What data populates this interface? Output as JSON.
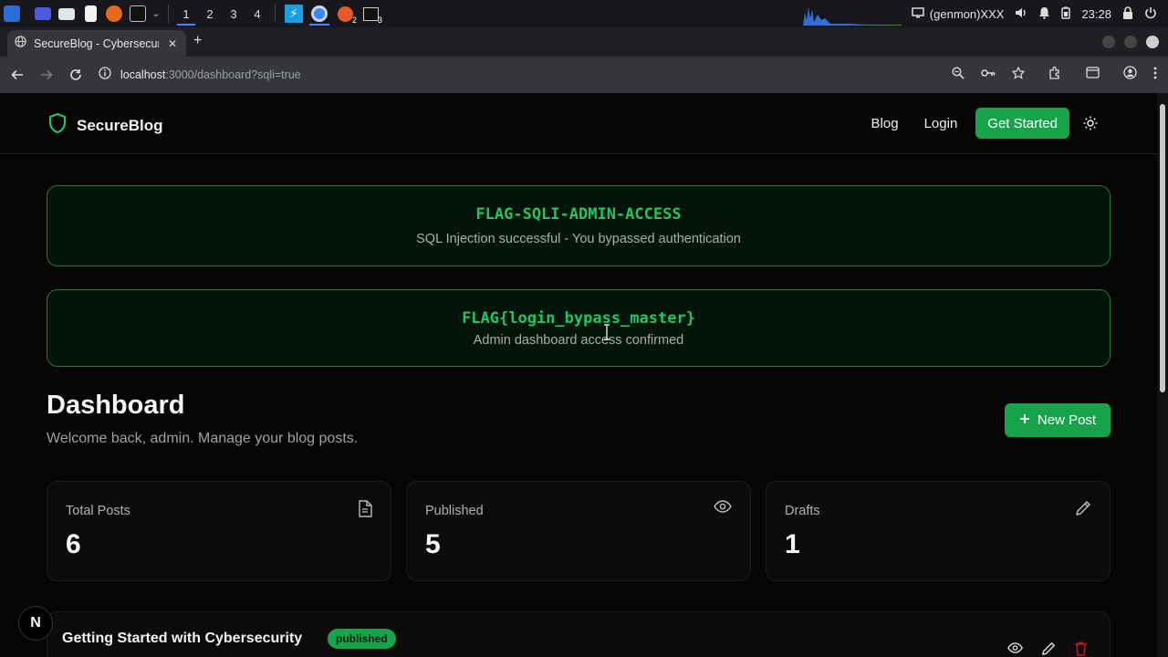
{
  "taskbar": {
    "workspaces": [
      "1",
      "2",
      "3",
      "4"
    ],
    "active_workspace": "1",
    "window_badges": [
      "2",
      "3"
    ],
    "genmon": "(genmon)XXX",
    "clock": "23:28"
  },
  "browser": {
    "tab_title": "SecureBlog - Cybersecur",
    "url_host": "localhost",
    "url_rest": ":3000/dashboard?sqli=true"
  },
  "site": {
    "brand": "SecureBlog",
    "nav": {
      "blog": "Blog",
      "login": "Login",
      "cta": "Get Started"
    },
    "accent": "#16a34a"
  },
  "flags": [
    {
      "title": "FLAG-SQLI-ADMIN-ACCESS",
      "subtitle": "SQL Injection successful - You bypassed authentication"
    },
    {
      "title": "FLAG{login_bypass_master}",
      "subtitle": "Admin dashboard access confirmed"
    }
  ],
  "dashboard": {
    "title": "Dashboard",
    "subtitle": "Welcome back, admin. Manage your blog posts.",
    "new_post": "New Post",
    "stats": [
      {
        "label": "Total Posts",
        "value": "6",
        "icon": "document-icon"
      },
      {
        "label": "Published",
        "value": "5",
        "icon": "eye-icon"
      },
      {
        "label": "Drafts",
        "value": "1",
        "icon": "pencil-icon"
      }
    ],
    "posts": [
      {
        "title": "Getting Started with Cybersecurity",
        "status": "published"
      }
    ]
  },
  "dev_badge": "N"
}
